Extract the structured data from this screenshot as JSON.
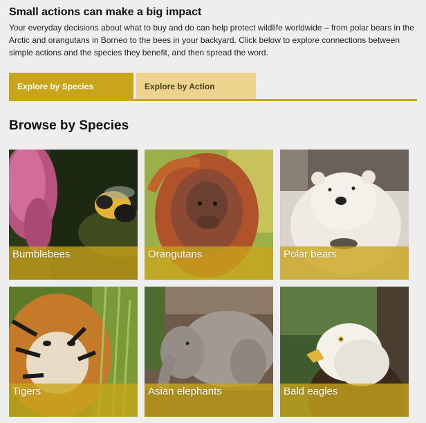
{
  "intro": {
    "title": "Small actions can make a big impact",
    "text": "Your everyday decisions about what to buy and do can help protect wildlife worldwide – from polar bears in the Arctic and orangutans in Borneo to the bees in your backyard. Click below to explore connections between simple actions and the species they benefit, and then spread the word."
  },
  "tabs": [
    {
      "label": "Explore by Species",
      "active": true
    },
    {
      "label": "Explore by Action",
      "active": false
    }
  ],
  "section_title": "Browse by Species",
  "species": [
    {
      "name": "Bumblebees",
      "photo": "bumblebee-photo"
    },
    {
      "name": "Orangutans",
      "photo": "orangutan-photo"
    },
    {
      "name": "Polar bears",
      "photo": "polar-bear-photo"
    },
    {
      "name": "Tigers",
      "photo": "tiger-photo"
    },
    {
      "name": "Asian elephants",
      "photo": "asian-elephant-photo"
    },
    {
      "name": "Bald eagles",
      "photo": "bald-eagle-photo"
    }
  ],
  "colors": {
    "accent": "#c9a519",
    "tab_inactive": "#ecd38e",
    "background": "#eeeeee"
  }
}
